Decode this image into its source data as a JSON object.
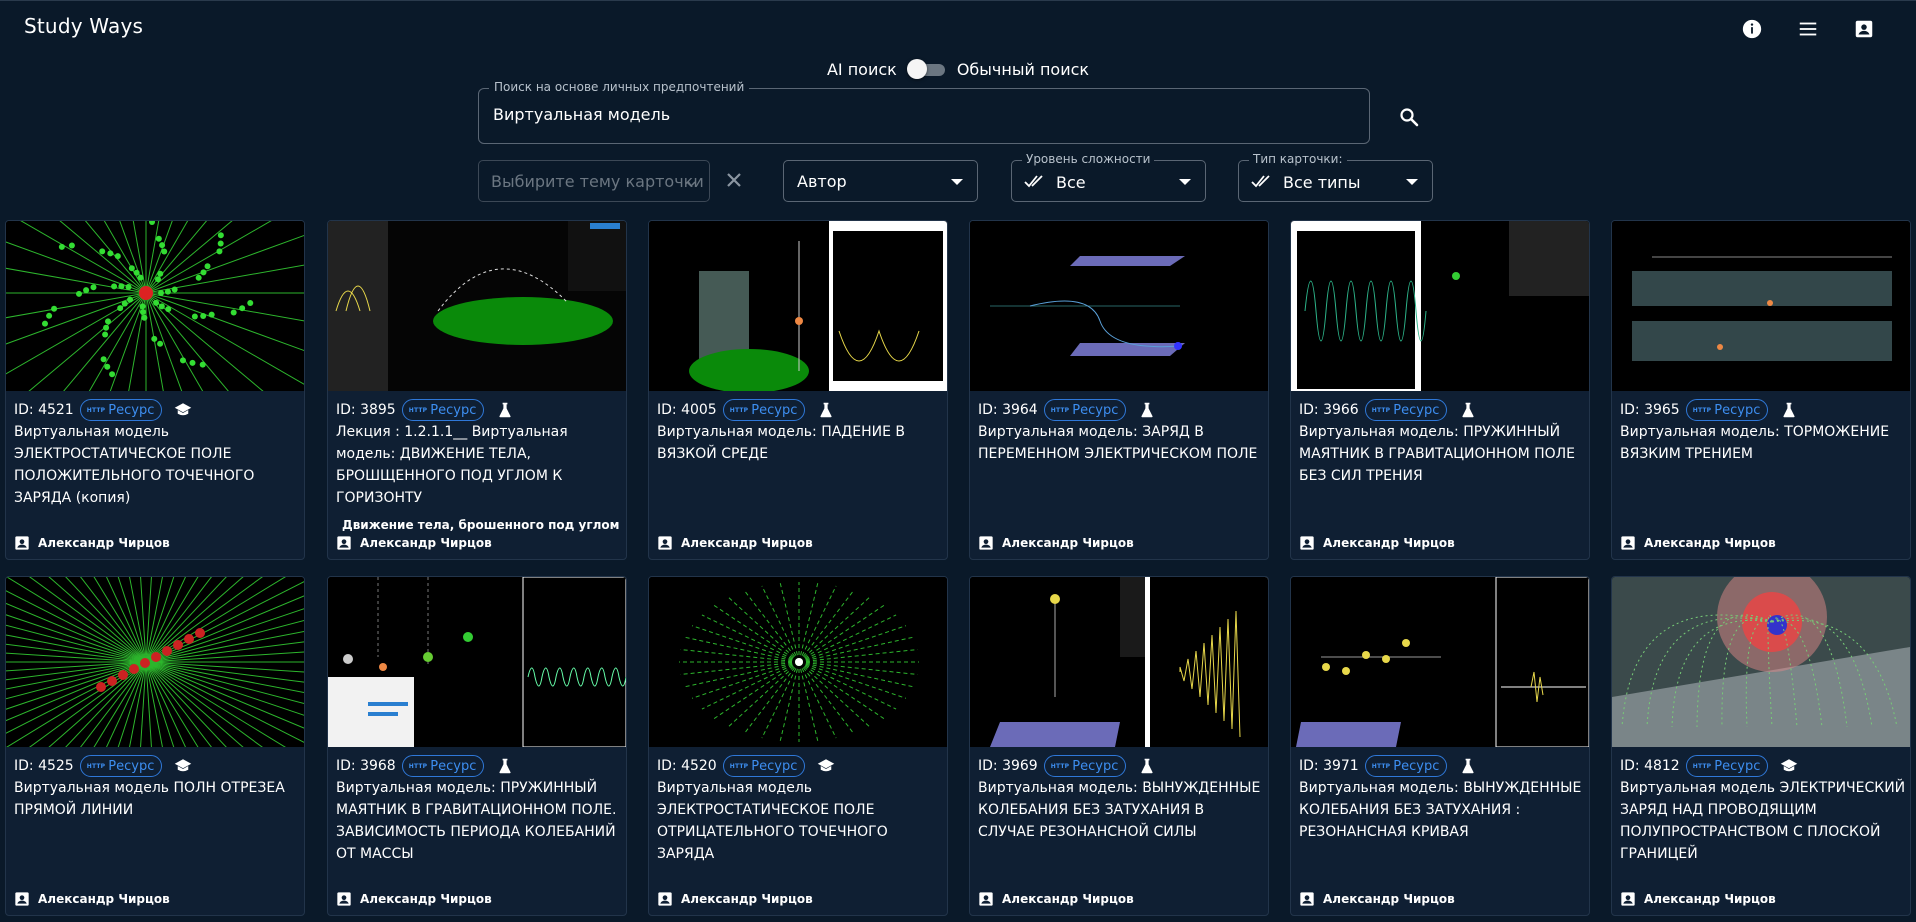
{
  "app": {
    "title": "Study Ways"
  },
  "header_icons": [
    "info-icon",
    "menu-icon",
    "account-box-icon"
  ],
  "search_mode": {
    "ai_label": "AI поиск",
    "normal_label": "Обычный поиск",
    "ai_enabled": false
  },
  "search": {
    "label": "Поиск на основе личных предпочтений",
    "value": "Виртуальная модель"
  },
  "filters": {
    "topic": {
      "placeholder": "Выбирите тему карточки"
    },
    "author": {
      "value": "Автор"
    },
    "level": {
      "label": "Уровень сложности",
      "value": "Все"
    },
    "type": {
      "label": "Тип карточки:",
      "value": "Все типы"
    }
  },
  "colors": {
    "background": "#0a1929",
    "card": "#0f1f33",
    "chip": "#2f78d8"
  },
  "cards": [
    {
      "id": "ID: 4521",
      "chip": "Ресурс",
      "http": "HTTP",
      "type_icon": "school-icon",
      "title": "Виртуальная модель ЭЛЕКТРОСТАТИЧЕСКОЕ ПОЛЕ ПОЛОЖИТЕЛЬНОГО ТОЧЕЧНОГО ЗАРЯДА (копия)",
      "related": "",
      "author": "Александр Чирцов"
    },
    {
      "id": "ID: 3895",
      "chip": "Ресурс",
      "http": "HTTP",
      "type_icon": "flask-icon",
      "title": "Лекция : 1.2.1.1__ Виртуальная модель: ДВИЖЕНИЕ ТЕЛА, БРОШЩЕННОГО ПОД УГЛОМ К ГОРИЗОНТУ",
      "related": "Движение тела, брошенного под углом к г",
      "author": "Александр Чирцов"
    },
    {
      "id": "ID: 4005",
      "chip": "Ресурс",
      "http": "HTTP",
      "type_icon": "flask-icon",
      "title": "Виртуальная модель: ПАДЕНИЕ В ВЯЗКОЙ СРЕДЕ",
      "related": "",
      "author": "Александр Чирцов"
    },
    {
      "id": "ID: 3964",
      "chip": "Ресурс",
      "http": "HTTP",
      "type_icon": "flask-icon",
      "title": "Виртуальная модель: ЗАРЯД В ПЕРЕМЕННОМ ЭЛЕКТРИЧЕСКОМ ПОЛЕ",
      "related": "",
      "author": "Александр Чирцов"
    },
    {
      "id": "ID: 3966",
      "chip": "Ресурс",
      "http": "HTTP",
      "type_icon": "flask-icon",
      "title": "Виртуальная модель: ПРУЖИННЫЙ МАЯТНИК В ГРАВИТАЦИОННОМ ПОЛЕ БЕЗ СИЛ ТРЕНИЯ",
      "related": "",
      "author": "Александр Чирцов"
    },
    {
      "id": "ID: 3965",
      "chip": "Ресурс",
      "http": "HTTP",
      "type_icon": "flask-icon",
      "title": "Виртуальная модель: ТОРМОЖЕНИЕ ВЯЗКИМ ТРЕНИЕМ",
      "related": "",
      "author": "Александр Чирцов"
    },
    {
      "id": "ID: 4525",
      "chip": "Ресурс",
      "http": "HTTP",
      "type_icon": "school-icon",
      "title": "Виртуальная модель ПОЛН ОТРЕЗЕА ПРЯМОЙ ЛИНИИ",
      "related": "",
      "author": "Александр Чирцов"
    },
    {
      "id": "ID: 3968",
      "chip": "Ресурс",
      "http": "HTTP",
      "type_icon": "flask-icon",
      "title": "Виртуальная модель: ПРУЖИННЫЙ МАЯТНИК В ГРАВИТАЦИОННОМ ПОЛЕ. ЗАВИСИМОСТЬ ПЕРИОДА КОЛЕБАНИЙ ОТ МАССЫ",
      "related": "",
      "author": "Александр Чирцов"
    },
    {
      "id": "ID: 4520",
      "chip": "Ресурс",
      "http": "HTTP",
      "type_icon": "school-icon",
      "title": "Виртуальная модель ЭЛЕКТРОСТАТИЧЕСКОЕ ПОЛЕ ОТРИЦАТЕЛЬНОГО ТОЧЕЧНОГО ЗАРЯДА",
      "related": "",
      "author": "Александр Чирцов"
    },
    {
      "id": "ID: 3969",
      "chip": "Ресурс",
      "http": "HTTP",
      "type_icon": "flask-icon",
      "title": "Виртуальная модель: ВЫНУЖДЕННЫЕ КОЛЕБАНИЯ БЕЗ ЗАТУХАНИЯ В СЛУЧАЕ РЕЗОНАНСНОЙ СИЛЫ",
      "related": "",
      "author": "Александр Чирцов"
    },
    {
      "id": "ID: 3971",
      "chip": "Ресурс",
      "http": "HTTP",
      "type_icon": "flask-icon",
      "title": "Виртуальная модель: ВЫНУЖДЕННЫЕ КОЛЕБАНИЯ БЕЗ ЗАТУХАНИЯ : РЕЗОНАНСНАЯ КРИВАЯ",
      "related": "",
      "author": "Александр Чирцов"
    },
    {
      "id": "ID: 4812",
      "chip": "Ресурс",
      "http": "HTTP",
      "type_icon": "school-icon",
      "title": "Виртуальная модель ЭЛЕКТРИЧЕСКИЙ ЗАРЯД НАД ПРОВОДЯЩИМ ПОЛУПРОСТРАНСТВОМ С ПЛОСКОЙ ГРАНИЦЕЙ",
      "related": "",
      "author": "Александр Чирцов"
    }
  ]
}
